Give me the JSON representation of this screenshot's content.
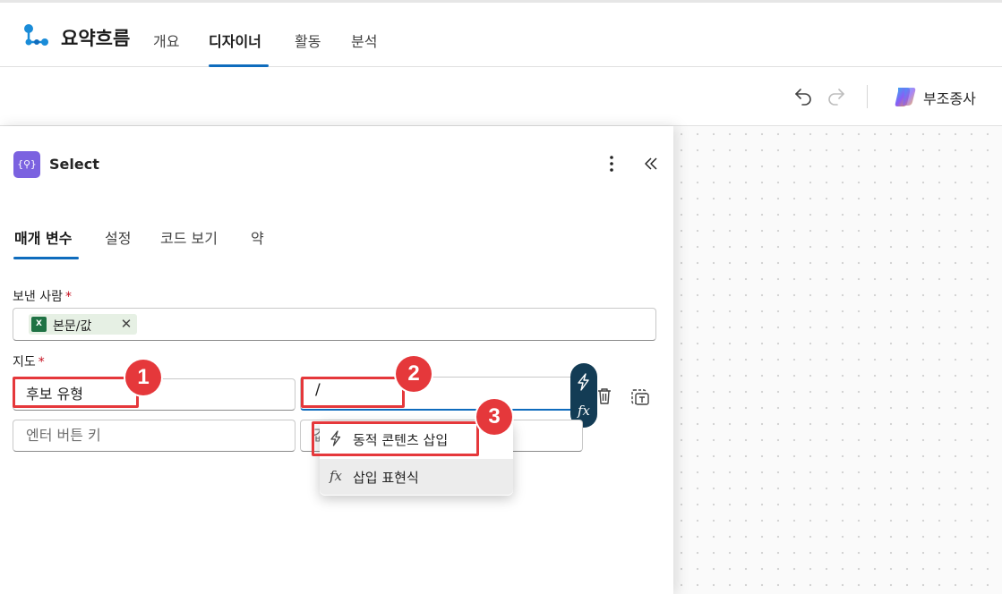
{
  "header": {
    "app_title": "요약흐름",
    "tabs": [
      {
        "label": "개요",
        "active": false
      },
      {
        "label": "디자이너",
        "active": true
      },
      {
        "label": "활동",
        "active": false
      },
      {
        "label": "분석",
        "active": false
      }
    ]
  },
  "toolbar": {
    "copilot_label": "부조종사",
    "undo_icon": "undo-icon",
    "redo_icon": "redo-icon"
  },
  "panel": {
    "title": "Select",
    "action_icon_text": "{⚲}",
    "tabs": [
      {
        "label": "매개 변수",
        "active": true
      },
      {
        "label": "설정",
        "active": false
      },
      {
        "label": "코드 보기",
        "active": false
      },
      {
        "label": "약",
        "active": false
      }
    ],
    "from_field": {
      "label": "보낸 사람",
      "required_mark": "*",
      "token_label": "본문/값",
      "token_icon_text": "X"
    },
    "map_field": {
      "label": "지도",
      "required_mark": "*",
      "row1_key": "후보 유형",
      "row1_value": "/",
      "row2_key_placeholder": "엔터 버튼 키",
      "row2_value_placeholder": "값"
    },
    "side_pill": {
      "dynamic_icon": "lightning-icon",
      "expression_text": "fx"
    }
  },
  "dropdown": {
    "items": [
      {
        "label": "동적 콘텐츠 삽입",
        "icon": "lightning-icon"
      },
      {
        "label": "삽입 표현식",
        "icon_text": "fx"
      }
    ]
  },
  "annotations": {
    "badges": [
      "1",
      "2",
      "3"
    ],
    "color": "#e5383b"
  },
  "colors": {
    "accent": "#0f6cbd",
    "pill": "#133c55",
    "action_icon": "#7b62e0",
    "excel": "#1f7244"
  }
}
